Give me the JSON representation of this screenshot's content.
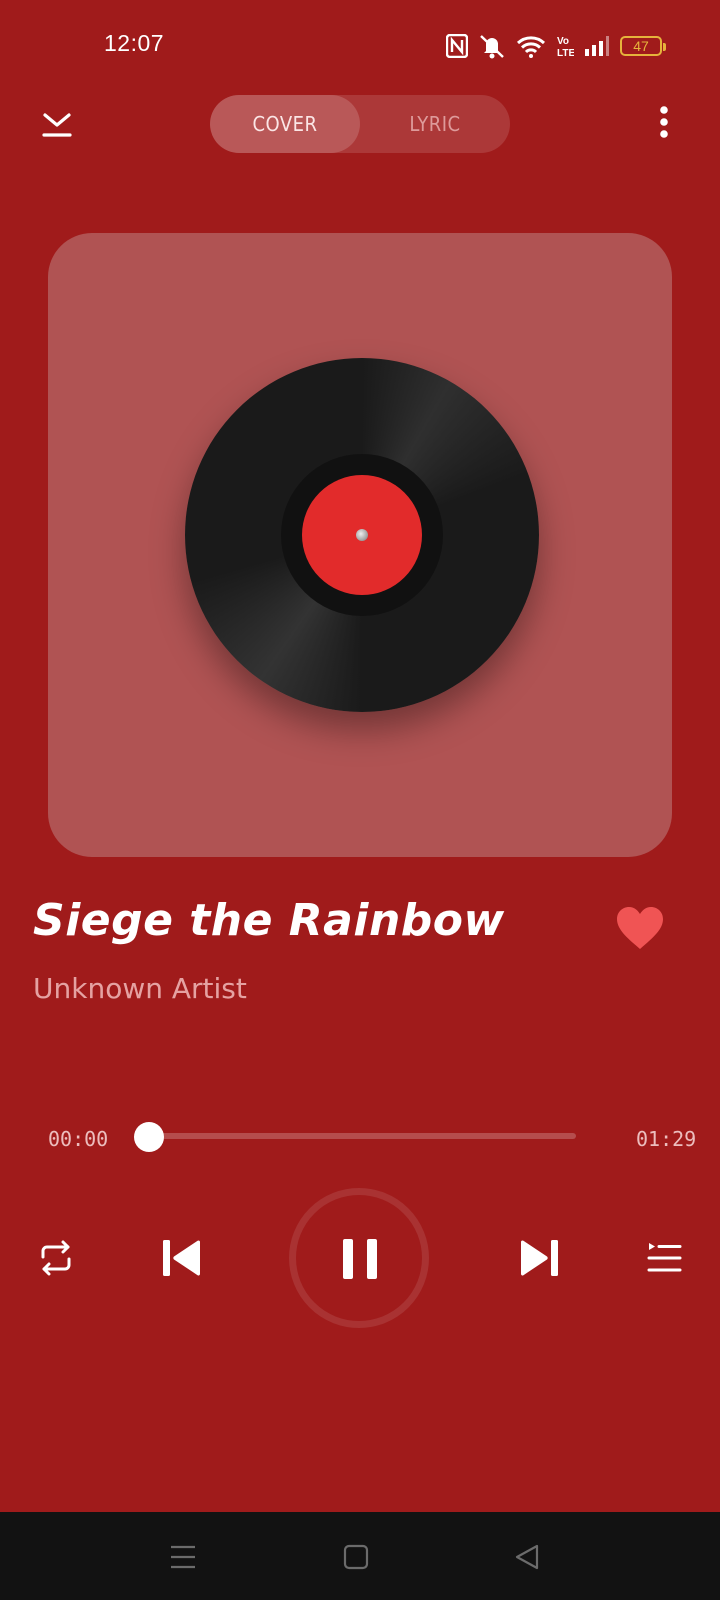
{
  "status_bar": {
    "time": "12:07",
    "battery": "47",
    "icons": [
      "nfc-icon",
      "bell-muted-icon",
      "wifi-icon",
      "volte-icon",
      "signal-icon",
      "battery-icon"
    ],
    "battery_color": "#e6b33c"
  },
  "header": {
    "collapse_icon": "chevron-down-icon",
    "menu_icon": "more-vertical-icon",
    "tabs": [
      {
        "label": "COVER",
        "selected": true
      },
      {
        "label": "LYRIC",
        "selected": false
      }
    ]
  },
  "song": {
    "title": "Siege the Rainbow",
    "artist": "Unknown Artist",
    "favorite": true
  },
  "playback": {
    "current_time": "00:00",
    "total_time": "01:29",
    "progress": 0,
    "state": "playing"
  },
  "controls": [
    "repeat-icon",
    "skip-previous-icon",
    "pause-icon",
    "skip-next-icon",
    "queue-icon"
  ],
  "nav_bar": [
    "menu-icon",
    "home-icon",
    "back-icon"
  ],
  "colors": {
    "background": "#a01b1b",
    "cover_card": "#b05353",
    "vinyl_label": "#e22b2b",
    "heart": "#f05454"
  }
}
